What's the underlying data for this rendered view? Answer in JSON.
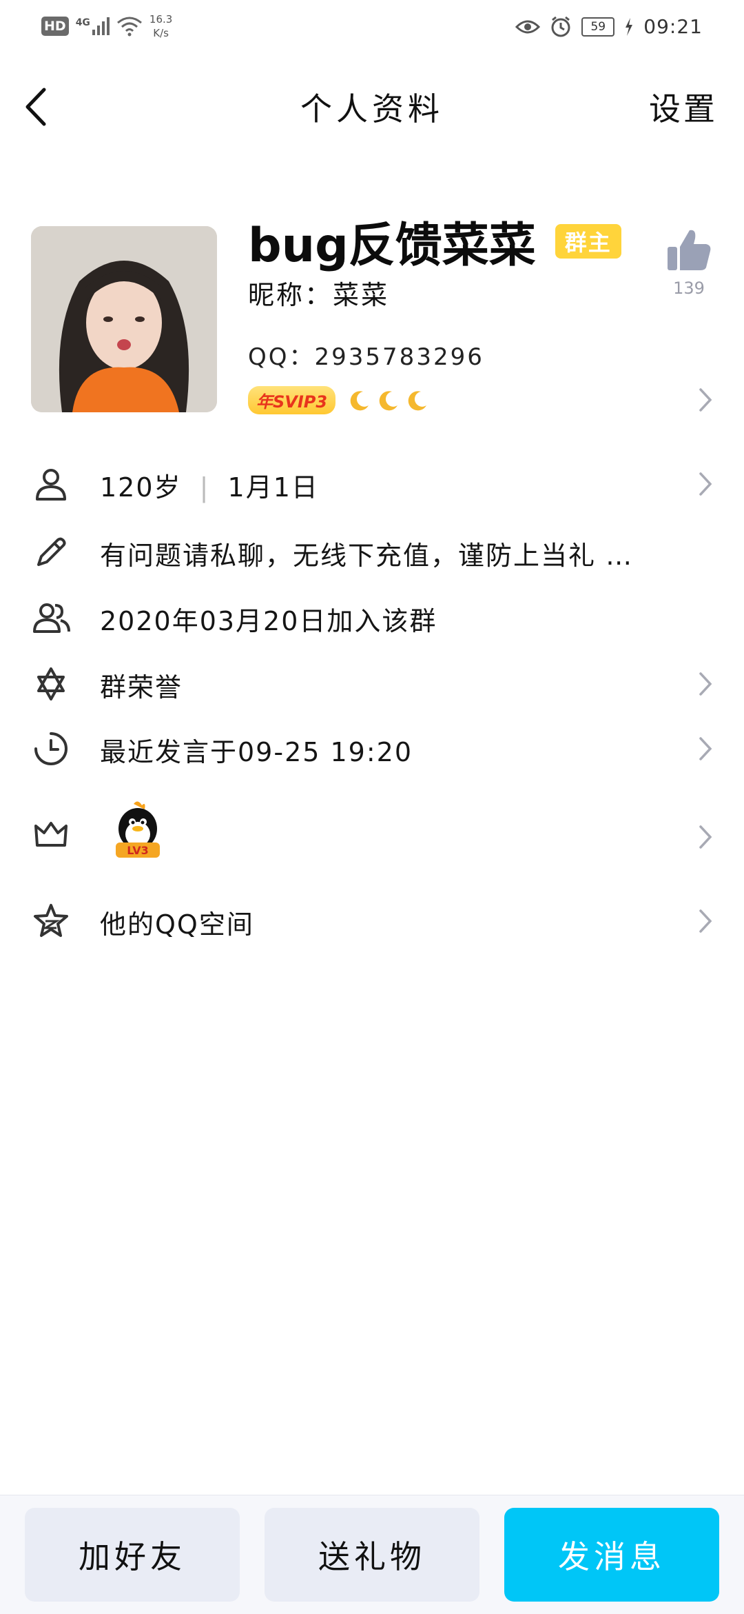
{
  "status_bar": {
    "hd": "HD",
    "network": "4G",
    "speed_value": "16.3",
    "speed_unit": "K/s",
    "battery": "59",
    "time": "09:21",
    "icons": [
      "eye-icon",
      "alarm-icon",
      "battery-icon",
      "charging-icon",
      "signal-icon",
      "wifi-icon"
    ]
  },
  "nav": {
    "title": "个人资料",
    "settings_label": "设置"
  },
  "profile": {
    "name": "bug反馈菜菜",
    "role_badge": "群主",
    "nickname": "昵称：菜菜",
    "qq": "QQ：2935783296",
    "svip": "年SVIP3",
    "moons": 3,
    "likes": "139"
  },
  "info": {
    "age": "120岁",
    "birthday": "1月1日",
    "signature": "有问题请私聊，无线下充值，谨防上当礼 …",
    "join_date": "2020年03月20日加入该群",
    "honor": "群荣誉",
    "last_speak": "最近发言于09-25 19:20",
    "level_badge": "LV3",
    "qzone": "他的QQ空间"
  },
  "actions": {
    "add_friend": "加好友",
    "send_gift": "送礼物",
    "send_message": "发消息"
  },
  "colors": {
    "accent": "#00c6f7",
    "owner_badge": "#ffd43b",
    "muted": "#9a9ca8"
  }
}
